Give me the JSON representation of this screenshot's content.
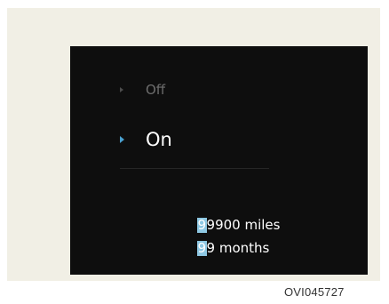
{
  "menu": {
    "options": [
      {
        "label": "Off",
        "selected": false
      },
      {
        "label": "On",
        "selected": true
      }
    ]
  },
  "values": {
    "miles": {
      "cursor_char": "9",
      "rest": "9900 miles"
    },
    "months": {
      "cursor_char": "9",
      "rest": "9 months"
    }
  },
  "reference_code": "OVI045727",
  "colors": {
    "screen_background": "#0e0e0e",
    "frame_background": "#f1efe5",
    "accent": "#4aa0cf",
    "cursor_highlight": "#8ec8e3",
    "inactive_text": "#6d6d6d"
  }
}
